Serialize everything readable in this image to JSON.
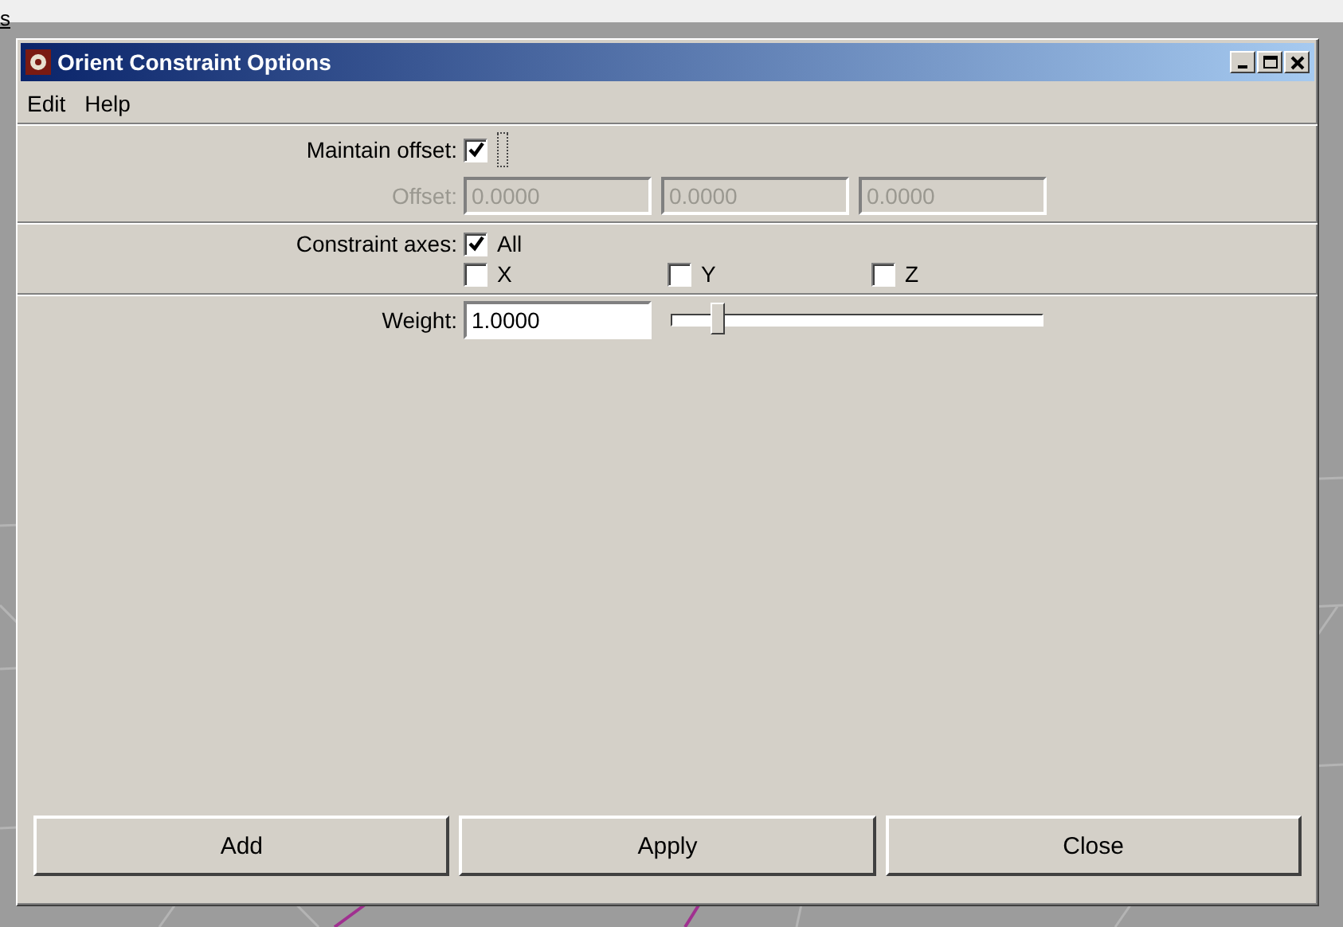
{
  "background": {
    "fragment": "s"
  },
  "window": {
    "title": "Orient Constraint Options"
  },
  "menu": [
    {
      "label": "Edit"
    },
    {
      "label": "Help"
    }
  ],
  "maintain_offset": {
    "label": "Maintain offset:",
    "checked": true
  },
  "offset": {
    "label": "Offset:",
    "disabled": true,
    "values": [
      "0.0000",
      "0.0000",
      "0.0000"
    ]
  },
  "constraint_axes": {
    "label": "Constraint axes:",
    "all": {
      "label": "All",
      "checked": true
    },
    "axes": [
      {
        "label": "X",
        "checked": false
      },
      {
        "label": "Y",
        "checked": false
      },
      {
        "label": "Z",
        "checked": false
      }
    ]
  },
  "weight": {
    "label": "Weight:",
    "value": "1.0000",
    "level": 0.12
  },
  "buttons": [
    {
      "label": "Add"
    },
    {
      "label": "Apply"
    },
    {
      "label": "Close"
    }
  ]
}
